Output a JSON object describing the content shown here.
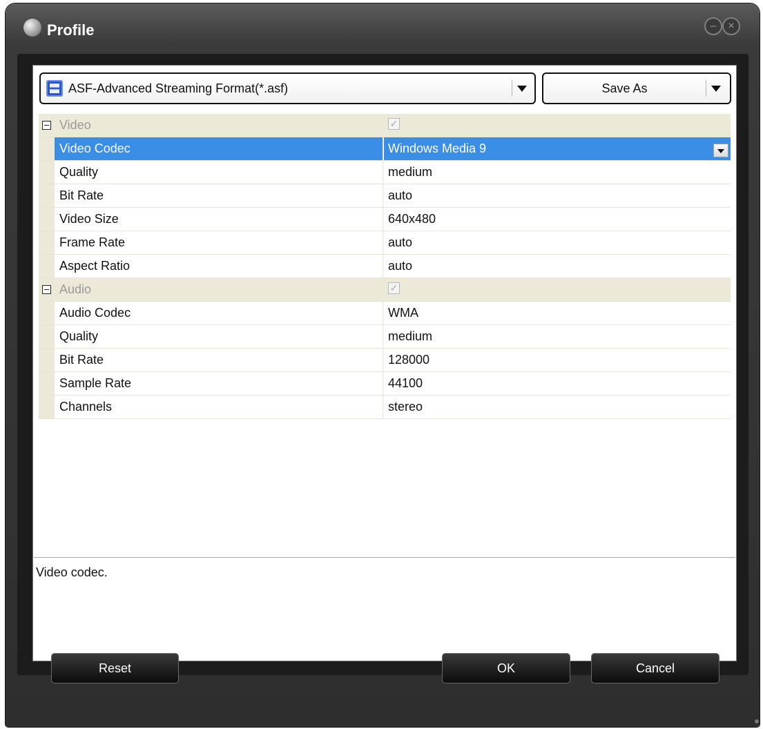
{
  "window": {
    "title": "Profile"
  },
  "format": {
    "selected": "ASF-Advanced Streaming Format(*.asf)"
  },
  "save_as": {
    "label": "Save As"
  },
  "video": {
    "label": "Video",
    "rows": [
      {
        "name": "Video Codec",
        "value": "Windows Media 9"
      },
      {
        "name": "Quality",
        "value": "medium"
      },
      {
        "name": "Bit Rate",
        "value": "auto"
      },
      {
        "name": "Video Size",
        "value": "640x480"
      },
      {
        "name": "Frame Rate",
        "value": "auto"
      },
      {
        "name": "Aspect Ratio",
        "value": "auto"
      }
    ]
  },
  "audio": {
    "label": "Audio",
    "rows": [
      {
        "name": "Audio Codec",
        "value": "WMA"
      },
      {
        "name": "Quality",
        "value": "medium"
      },
      {
        "name": "Bit Rate",
        "value": "128000"
      },
      {
        "name": "Sample Rate",
        "value": "44100"
      },
      {
        "name": "Channels",
        "value": "stereo"
      }
    ]
  },
  "description": "Video codec.",
  "buttons": {
    "reset": "Reset",
    "ok": "OK",
    "cancel": "Cancel"
  },
  "colors": {
    "selection": "#3a8ee6",
    "category_bg": "#ece9d8",
    "window_bg": "#2e2e2e"
  }
}
